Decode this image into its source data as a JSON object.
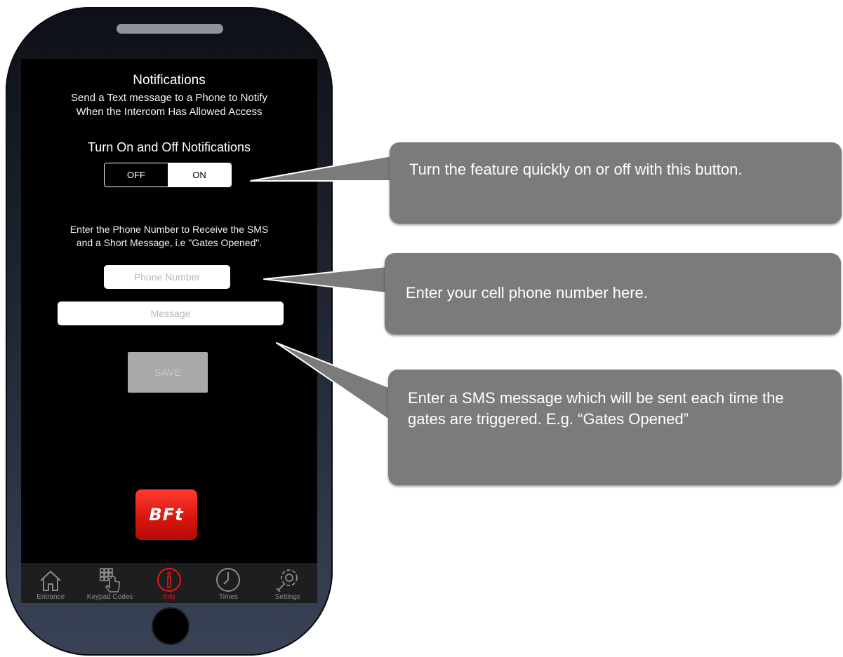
{
  "screen": {
    "title": "Notifications",
    "description_line1": "Send a Text message to  a Phone to Notify",
    "description_line2": "When the Intercom Has Allowed Access",
    "toggle_heading": "Turn On and Off Notifications",
    "toggle": {
      "off_label": "OFF",
      "on_label": "ON",
      "selected": "ON"
    },
    "instructions_line1": "Enter the Phone Number to Receive the SMS",
    "instructions_line2": "and a Short Message, i.e \"Gates Opened\".",
    "phone_field": {
      "placeholder": "Phone Number",
      "value": ""
    },
    "message_field": {
      "placeholder": "Message",
      "value": ""
    },
    "save_label": "SAVE",
    "logo_text": "BFt"
  },
  "tabbar": {
    "tabs": [
      {
        "label": "Entrance",
        "icon": "home-icon",
        "active": false
      },
      {
        "label": "Keypad Codes",
        "icon": "keypad-icon",
        "active": false
      },
      {
        "label": "Info",
        "icon": "info-icon",
        "active": true
      },
      {
        "label": "Times",
        "icon": "clock-icon",
        "active": false
      },
      {
        "label": "Settings",
        "icon": "gear-wrench-icon",
        "active": false
      }
    ],
    "active_color": "#e8161a"
  },
  "callouts": {
    "toggle_tip": "Turn the feature quickly on or off with this button.",
    "phone_tip": "Enter your cell phone number here.",
    "message_tip": "Enter a SMS message which will be sent each time the gates are triggered. E.g. “Gates Opened”"
  },
  "colors": {
    "callout_background": "#7b7b7b",
    "save_disabled": "#a8a8a8",
    "brand_red": "#d6140d"
  }
}
